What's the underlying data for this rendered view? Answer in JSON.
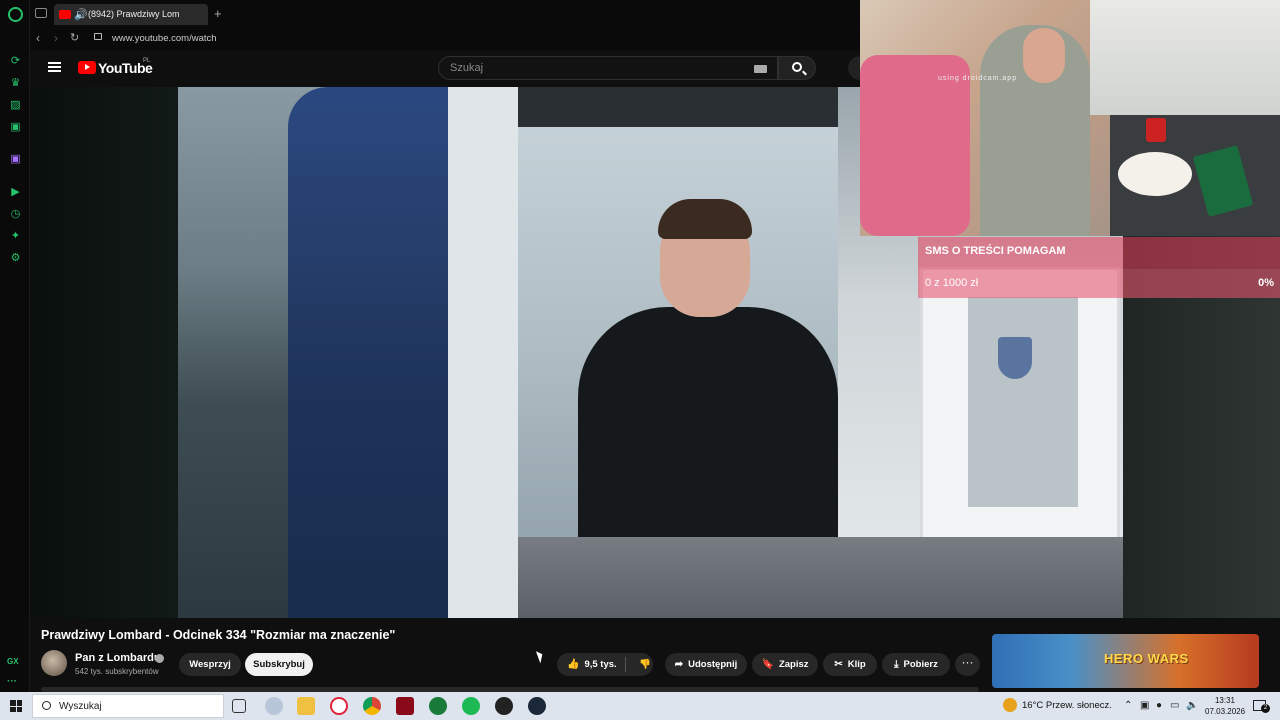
{
  "browser": {
    "tab_title": "(8942) Prawdziwy Lom",
    "url": "www.youtube.com/watch",
    "new_tab_label": "+"
  },
  "youtube": {
    "logo_text": "YouTube",
    "country_code": "PL",
    "search_placeholder": "Szukaj"
  },
  "stream_overlay": {
    "webcam_watermark": "using droidcam.app",
    "donation_title": "SMS O TREŚCI POMAGAM",
    "donation_amount": "0 z 1000 zł",
    "donation_percent": "0%",
    "donation_progress": 0
  },
  "video": {
    "title": "Prawdziwy Lombard - Odcinek 334 \"Rozmiar ma znaczenie\"",
    "channel_name": "Pan z Lombardu",
    "subscribers": "542 tys. subskrybentów",
    "support_label": "Wesprzyj",
    "subscribe_label": "Subskrybuj",
    "likes": "9,5 tys.",
    "share_label": "Udostępnij",
    "save_label": "Zapisz",
    "clip_label": "Klip",
    "download_label": "Pobierz",
    "more_label": "···"
  },
  "ad": {
    "text": "HERO WARS"
  },
  "taskbar": {
    "search_label": "Wyszukaj",
    "weather": "16°C  Przew. słonecz.",
    "time": "13:31",
    "date": "07.03.2026",
    "notification_count": "2"
  },
  "sidebar": {
    "gx_label": "GX"
  },
  "colors": {
    "gx_accent": "#25c26b",
    "youtube_red": "#ff0000",
    "donation_bar": "#e63c5a"
  }
}
